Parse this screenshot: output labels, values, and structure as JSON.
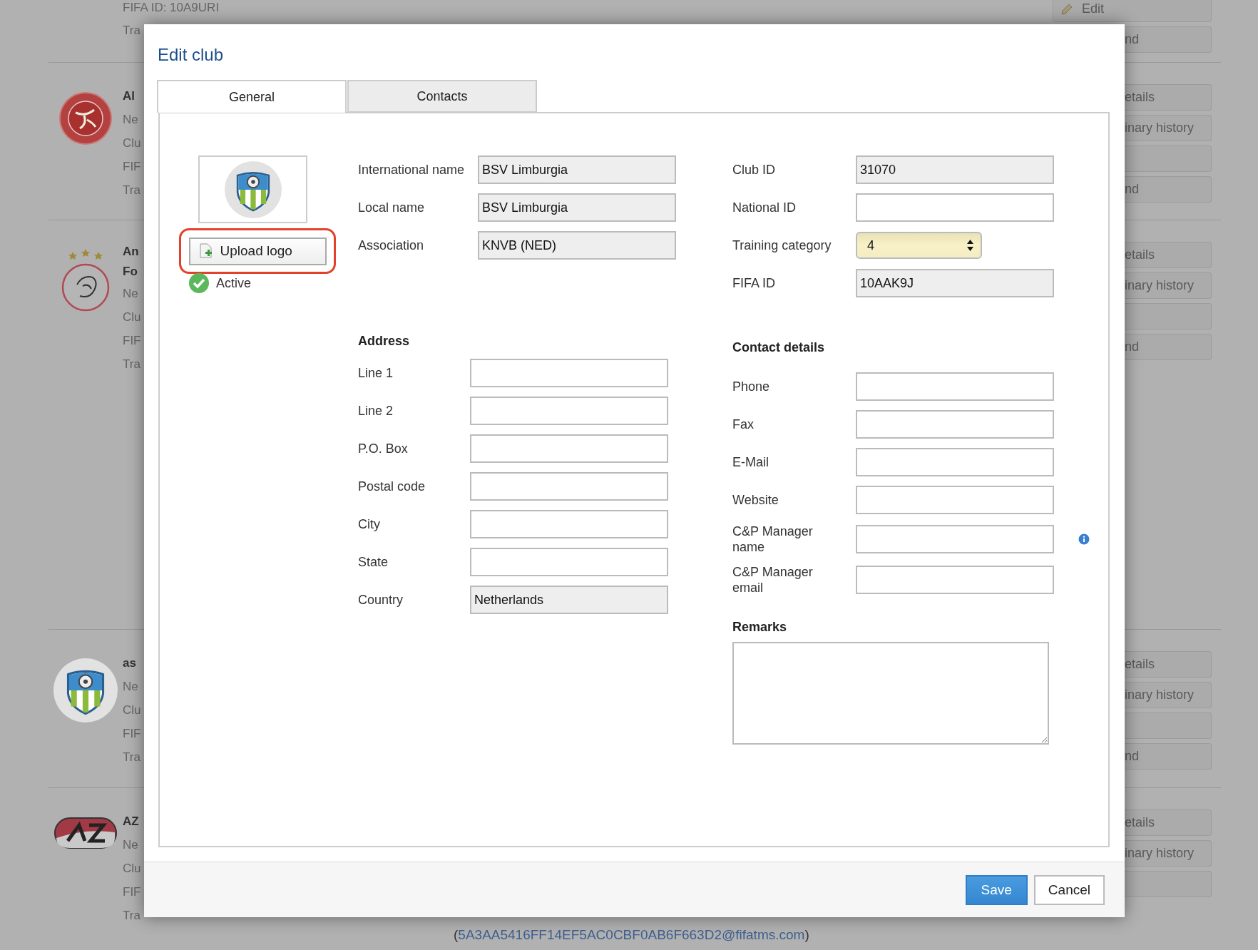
{
  "background_page": {
    "top_card": {
      "lines": [
        "FIFA ID: 10A9URI",
        "Tra"
      ],
      "buttons": [
        {
          "kind": "text",
          "label": "Edit"
        },
        {
          "kind": "text",
          "label": "nd"
        }
      ]
    },
    "cards": [
      {
        "kind": "roundel",
        "name_lines": [
          "Al"
        ],
        "lines": [
          "Ne",
          "Clu",
          "FIF",
          "Tra"
        ],
        "buttons": [
          {
            "kind": "text",
            "label": "etails"
          },
          {
            "kind": "text",
            "label": "inary history"
          },
          {
            "kind": "blank"
          },
          {
            "kind": "text",
            "label": "nd"
          }
        ]
      },
      {
        "kind": "starred",
        "name_lines": [
          "An",
          "Fo"
        ],
        "lines": [
          "Ne",
          "Clu",
          "FIF",
          "Tra"
        ],
        "buttons": [
          {
            "kind": "text",
            "label": "etails"
          },
          {
            "kind": "text",
            "label": "inary history"
          },
          {
            "kind": "blank"
          },
          {
            "kind": "text",
            "label": "nd"
          }
        ]
      },
      {
        "kind": "shield",
        "name_lines": [
          "as"
        ],
        "lines": [
          "Ne",
          "Clu",
          "FIF",
          "Tra"
        ],
        "buttons": [
          {
            "kind": "text",
            "label": "etails"
          },
          {
            "kind": "text",
            "label": "inary history"
          },
          {
            "kind": "blank"
          },
          {
            "kind": "text",
            "label": "nd"
          }
        ]
      },
      {
        "kind": "oval",
        "name_lines": [
          "AZ"
        ],
        "lines": [
          "Ne",
          "Clu",
          "FIF",
          "Tra"
        ],
        "buttons": [
          {
            "kind": "text",
            "label": "etails"
          },
          {
            "kind": "text",
            "label": "inary history"
          },
          {
            "kind": "blank"
          }
        ]
      }
    ],
    "footer_email": {
      "prefix": "(",
      "email": "5A3AA5416FF14EF5AC0CBF0AB6F663D2@fifatms.com",
      "suffix": ")"
    }
  },
  "dialog": {
    "title": "Edit club",
    "tabs": [
      {
        "label": "General",
        "selected": true
      },
      {
        "label": "Contacts",
        "selected": false
      }
    ],
    "logo_panel": {
      "upload_button": "Upload logo",
      "upload_highlighted": true,
      "status": {
        "label": "Active",
        "active": true
      }
    },
    "identity": [
      {
        "label": "International name",
        "value": "BSV Limburgia",
        "readonly": true
      },
      {
        "label": "Local name",
        "value": "BSV Limburgia",
        "readonly": true
      },
      {
        "label": "Association",
        "value": "KNVB (NED)",
        "readonly": true
      }
    ],
    "ids": [
      {
        "label": "Club ID",
        "kind": "text",
        "value": "31070",
        "readonly": true
      },
      {
        "label": "National ID",
        "kind": "text",
        "readonly": false
      },
      {
        "label": "Training category",
        "kind": "select",
        "value": "4"
      },
      {
        "label": "FIFA ID",
        "kind": "text",
        "value": "10AAK9J",
        "readonly": true
      }
    ],
    "address": {
      "heading": "Address",
      "fields": [
        {
          "label": "Line 1",
          "readonly": false
        },
        {
          "label": "Line 2",
          "readonly": false
        },
        {
          "label": "P.O. Box",
          "readonly": false
        },
        {
          "label": "Postal code",
          "readonly": false
        },
        {
          "label": "City",
          "readonly": false
        },
        {
          "label": "State",
          "readonly": false
        },
        {
          "label": "Country",
          "value": "Netherlands",
          "readonly": true
        }
      ]
    },
    "contact": {
      "heading": "Contact details",
      "fields": [
        {
          "label": "Phone",
          "readonly": false,
          "info": false
        },
        {
          "label": "Fax",
          "readonly": false,
          "info": false
        },
        {
          "label": "E-Mail",
          "readonly": false,
          "info": false
        },
        {
          "label": "Website",
          "readonly": false,
          "info": false
        },
        {
          "label": "C&P Manager name",
          "readonly": false,
          "info": true
        },
        {
          "label": "C&P Manager email",
          "readonly": false,
          "info": false
        }
      ]
    },
    "remarks": {
      "heading": "Remarks"
    },
    "buttons": [
      {
        "label": "Save",
        "kind": "primary"
      },
      {
        "label": "Cancel",
        "kind": "secondary"
      }
    ]
  }
}
